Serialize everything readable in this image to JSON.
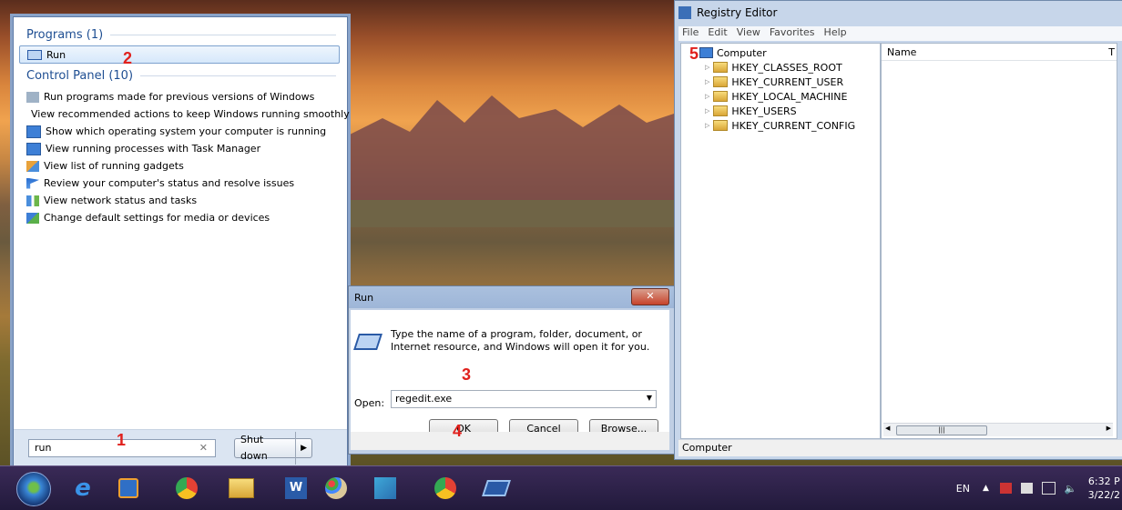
{
  "start_menu": {
    "programs_header": "Programs (1)",
    "run_item": "Run",
    "control_panel_header": "Control Panel (10)",
    "control_panel_items": [
      "Run programs made for previous versions of Windows",
      "View recommended actions to keep Windows running smoothly",
      "Show which operating system your computer is running",
      "View running processes with Task Manager",
      "View list of running gadgets",
      "Review your computer's status and resolve issues",
      "View network status and tasks",
      "Change default settings for media or devices"
    ],
    "search_value": "run",
    "shutdown_label": "Shut down"
  },
  "run_dialog": {
    "title": "Run",
    "description": "Type the name of a program, folder, document, or Internet resource, and Windows will open it for you.",
    "open_label": "Open:",
    "open_value": "regedit.exe",
    "ok_label": "OK",
    "cancel_label": "Cancel",
    "browse_label": "Browse..."
  },
  "registry_editor": {
    "title": "Registry Editor",
    "menu": [
      "File",
      "Edit",
      "View",
      "Favorites",
      "Help"
    ],
    "tree_root": "Computer",
    "tree_items": [
      "HKEY_CLASSES_ROOT",
      "HKEY_CURRENT_USER",
      "HKEY_LOCAL_MACHINE",
      "HKEY_USERS",
      "HKEY_CURRENT_CONFIG"
    ],
    "column_name": "Name",
    "column_type": "T",
    "status": "Computer"
  },
  "annotations": [
    "1",
    "2",
    "3",
    "4",
    "5"
  ],
  "taskbar": {
    "language": "EN",
    "time": "6:32 P",
    "date": "3/22/2"
  }
}
